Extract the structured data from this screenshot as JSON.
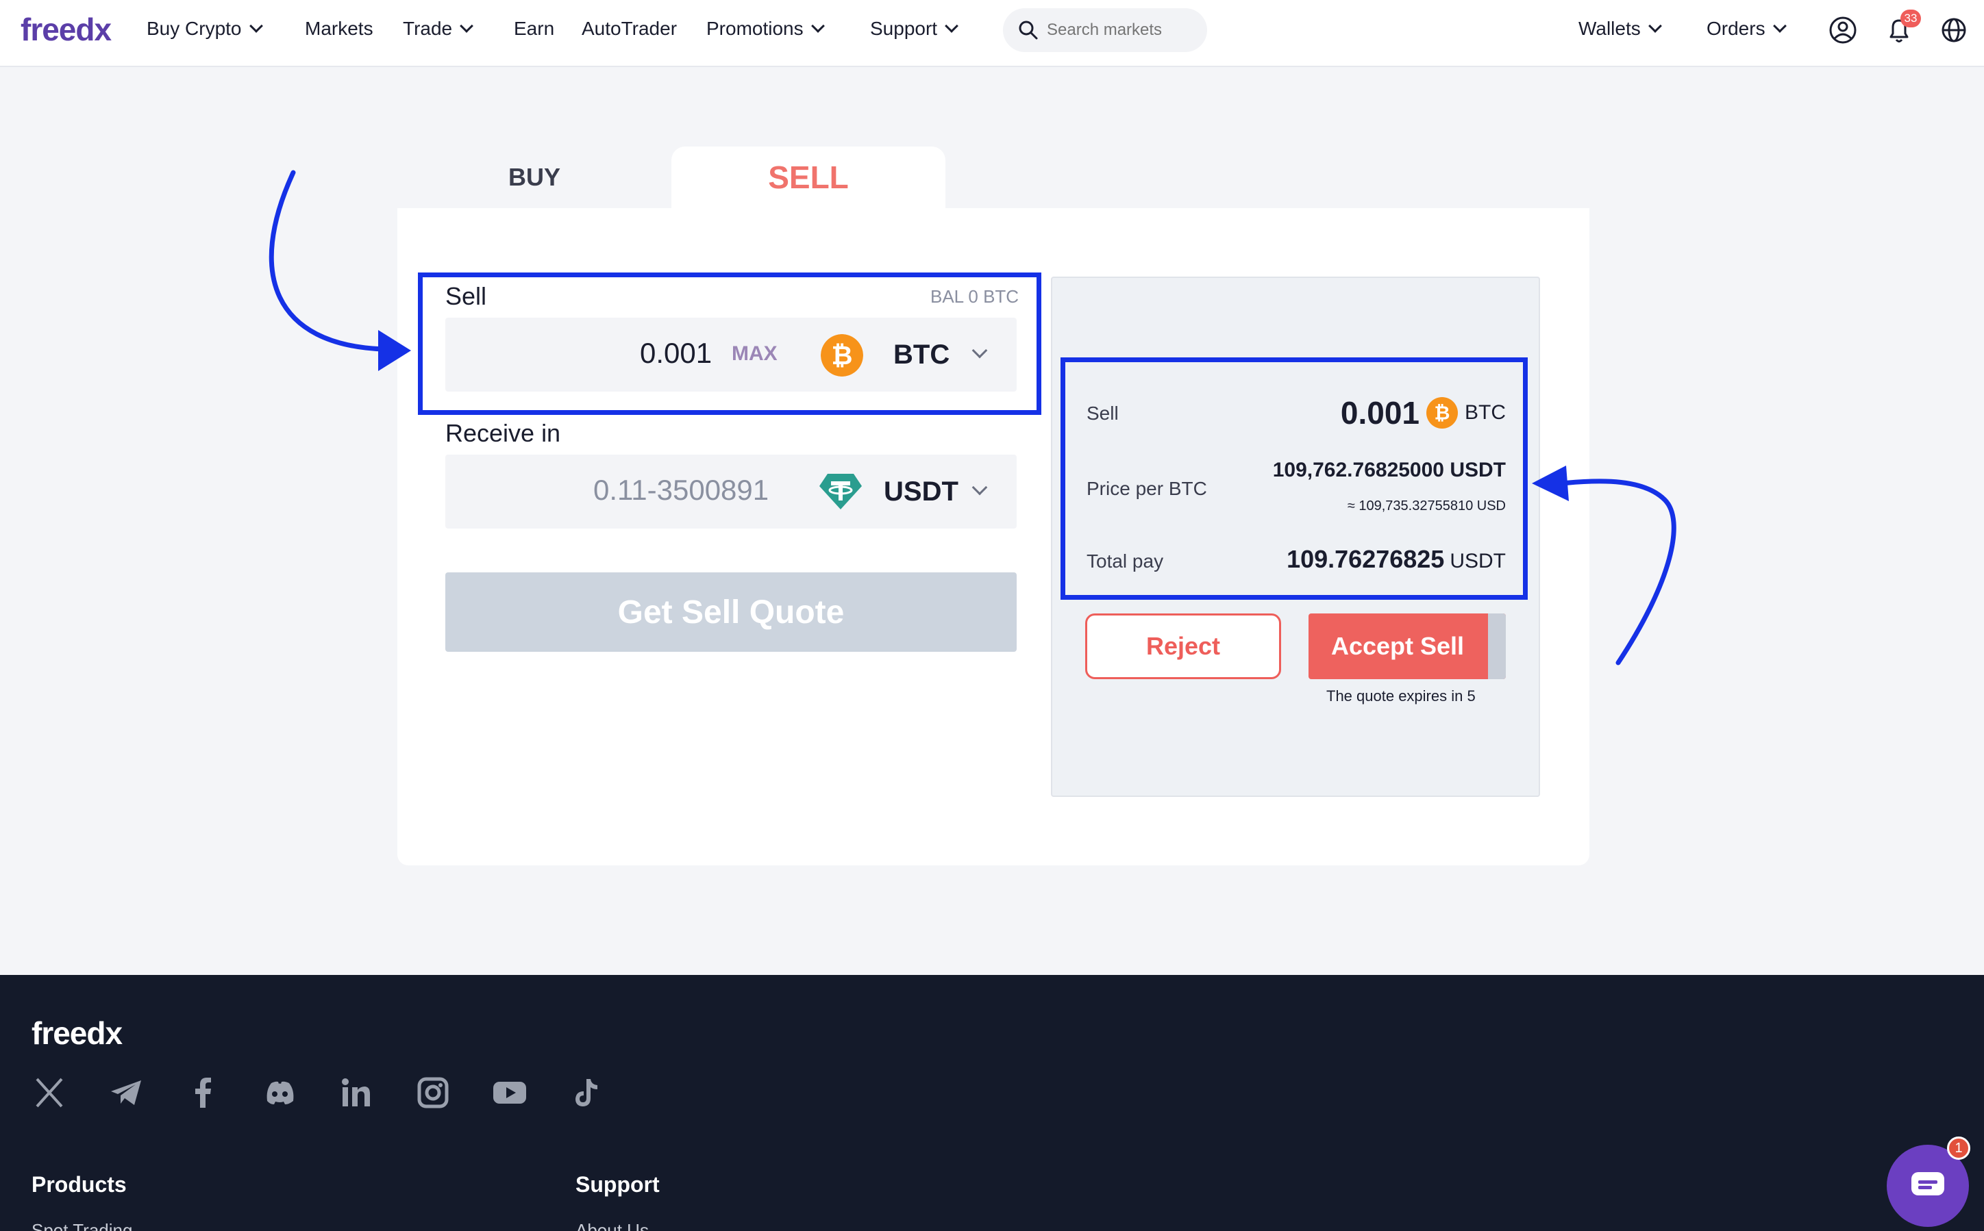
{
  "nav": {
    "logo": "freedx",
    "items": [
      {
        "label": "Buy Crypto"
      },
      {
        "label": "Markets"
      },
      {
        "label": "Trade"
      },
      {
        "label": "Earn"
      },
      {
        "label": "AutoTrader"
      },
      {
        "label": "Promotions"
      },
      {
        "label": "Support"
      }
    ],
    "search_placeholder": "Search markets",
    "wallets": "Wallets",
    "orders": "Orders",
    "notification_count": "33"
  },
  "tabs": {
    "buy": "BUY",
    "sell": "SELL",
    "active": "sell"
  },
  "form": {
    "sell_label": "Sell",
    "balance": "BAL 0 BTC",
    "sell_amount": "0.001",
    "max_label": "MAX",
    "sell_currency": "BTC",
    "receive_label": "Receive in",
    "receive_placeholder": "0.11-3500891",
    "receive_currency": "USDT",
    "quote_button": "Get Sell Quote"
  },
  "quote": {
    "sell_label": "Sell",
    "sell_amount": "0.001",
    "sell_currency": "BTC",
    "price_label": "Price per BTC",
    "price_value": "109,762.76825000 USDT",
    "price_usd": "≈ 109,735.32755810 USD",
    "total_label": "Total pay",
    "total_amount": "109.76276825",
    "total_currency": "USDT",
    "reject_label": "Reject",
    "accept_label": "Accept Sell",
    "expires_text": "The quote expires in 5"
  },
  "footer": {
    "logo": "freedx",
    "socials": [
      "x-icon",
      "telegram-icon",
      "facebook-icon",
      "discord-icon",
      "linkedin-icon",
      "instagram-icon",
      "youtube-icon",
      "tiktok-icon"
    ],
    "products_heading": "Products",
    "products_first_link": "Spot Trading",
    "support_heading": "Support",
    "support_first_link": "About Us"
  },
  "chat": {
    "badge": "1"
  },
  "colors": {
    "brand": "#5b3ea8",
    "accent": "#ee625e",
    "annotation": "#1531e6",
    "btc": "#f7931a",
    "usdt": "#2a9d8f"
  }
}
